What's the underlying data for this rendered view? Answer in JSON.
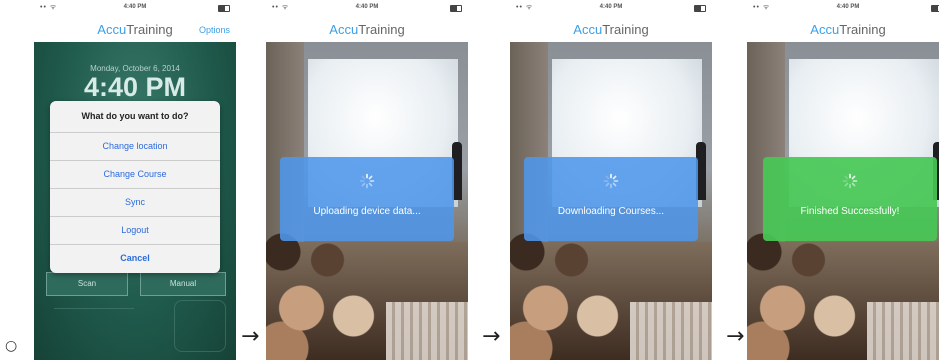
{
  "bullet": "○",
  "arrow": "→",
  "status_time": "4:40 PM",
  "status_signal": "•• ᯤ",
  "brand": {
    "accent": "Accu",
    "rest": "Training"
  },
  "screen1": {
    "options_label": "Options",
    "date": "Monday, October 6, 2014",
    "time": "4:40 PM",
    "dialog_title": "What do you want to do?",
    "menu": [
      "Change location",
      "Change Course",
      "Sync",
      "Logout",
      "Cancel"
    ],
    "scan_label": "Scan",
    "manual_label": "Manual"
  },
  "screen2": {
    "message": "Uploading device data..."
  },
  "screen3": {
    "message": "Downloading Courses..."
  },
  "screen4": {
    "message": "Finished Successfully!"
  },
  "colors": {
    "brand_blue": "#3aa0e8",
    "toast_blue": "#4e96eb",
    "toast_green": "#46c855",
    "menu_link": "#2c6bdc"
  },
  "icons": [
    "battery-icon",
    "wifi-icon",
    "spinner-icon"
  ]
}
